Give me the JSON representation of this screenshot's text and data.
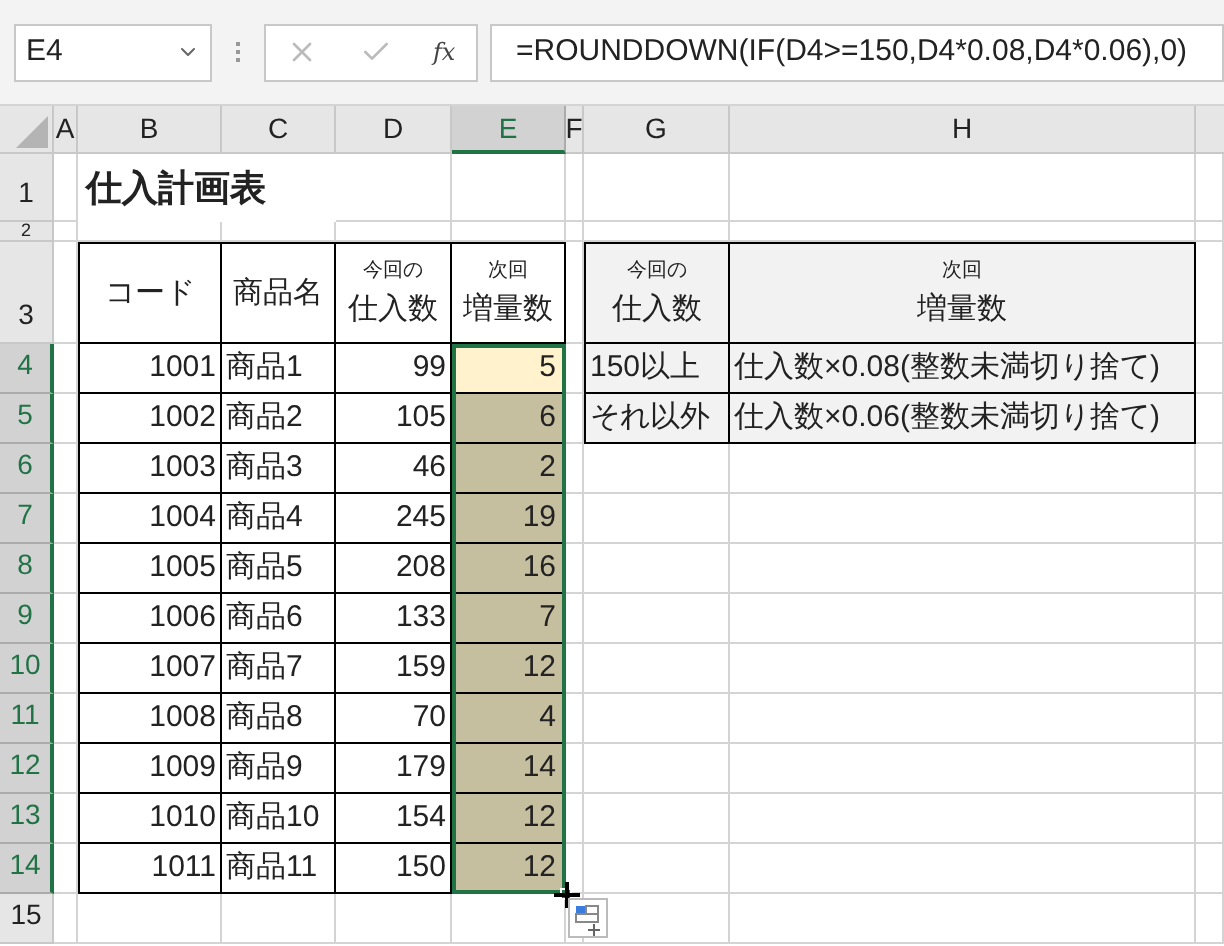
{
  "name_box": "E4",
  "formula_bar": {
    "function_label": "fx",
    "formula": "=ROUNDDOWN(IF(D4>=150,D4*0.08,D4*0.06),0)"
  },
  "columns": [
    {
      "label": "A",
      "selected": false
    },
    {
      "label": "B",
      "selected": false
    },
    {
      "label": "C",
      "selected": false
    },
    {
      "label": "D",
      "selected": false
    },
    {
      "label": "E",
      "selected": true
    },
    {
      "label": "F",
      "selected": false
    },
    {
      "label": "G",
      "selected": false
    },
    {
      "label": "H",
      "selected": false
    }
  ],
  "rows": [
    {
      "label": "1",
      "selected": false
    },
    {
      "label": "2",
      "selected": false
    },
    {
      "label": "3",
      "selected": false
    },
    {
      "label": "4",
      "selected": true
    },
    {
      "label": "5",
      "selected": true
    },
    {
      "label": "6",
      "selected": true
    },
    {
      "label": "7",
      "selected": true
    },
    {
      "label": "8",
      "selected": true
    },
    {
      "label": "9",
      "selected": true
    },
    {
      "label": "10",
      "selected": true
    },
    {
      "label": "11",
      "selected": true
    },
    {
      "label": "12",
      "selected": true
    },
    {
      "label": "13",
      "selected": true
    },
    {
      "label": "14",
      "selected": true
    },
    {
      "label": "15",
      "selected": false
    }
  ],
  "title": "仕入計画表",
  "purchase_table": {
    "headers": [
      {
        "label": "コード"
      },
      {
        "label": "商品名"
      },
      {
        "note": "今回の",
        "label": "仕入数"
      },
      {
        "note": "次回",
        "label": "増量数"
      }
    ],
    "items": [
      {
        "code": "1001",
        "name": "商品1",
        "quantity": "99",
        "increase": "5",
        "selected": false
      },
      {
        "code": "1002",
        "name": "商品2",
        "quantity": "105",
        "increase": "6",
        "selected": true
      },
      {
        "code": "1003",
        "name": "商品3",
        "quantity": "46",
        "increase": "2",
        "selected": true
      },
      {
        "code": "1004",
        "name": "商品4",
        "quantity": "245",
        "increase": "19",
        "selected": true
      },
      {
        "code": "1005",
        "name": "商品5",
        "quantity": "208",
        "increase": "16",
        "selected": true
      },
      {
        "code": "1006",
        "name": "商品6",
        "quantity": "133",
        "increase": "7",
        "selected": true
      },
      {
        "code": "1007",
        "name": "商品7",
        "quantity": "159",
        "increase": "12",
        "selected": true
      },
      {
        "code": "1008",
        "name": "商品8",
        "quantity": "70",
        "increase": "4",
        "selected": true
      },
      {
        "code": "1009",
        "name": "商品9",
        "quantity": "179",
        "increase": "14",
        "selected": true
      },
      {
        "code": "1010",
        "name": "商品10",
        "quantity": "154",
        "increase": "12",
        "selected": true
      },
      {
        "code": "1011",
        "name": "商品11",
        "quantity": "150",
        "increase": "12",
        "selected": true
      }
    ]
  },
  "rule_table": {
    "headers": [
      {
        "note": "今回の",
        "label": "仕入数"
      },
      {
        "note": "次回",
        "label": "増量数"
      }
    ],
    "rows": [
      {
        "condition": "150以上",
        "formula": "仕入数×0.08(整数未満切り捨て)"
      },
      {
        "condition": "それ以外",
        "formula": "仕入数×0.06(整数未満切り捨て)"
      }
    ]
  }
}
